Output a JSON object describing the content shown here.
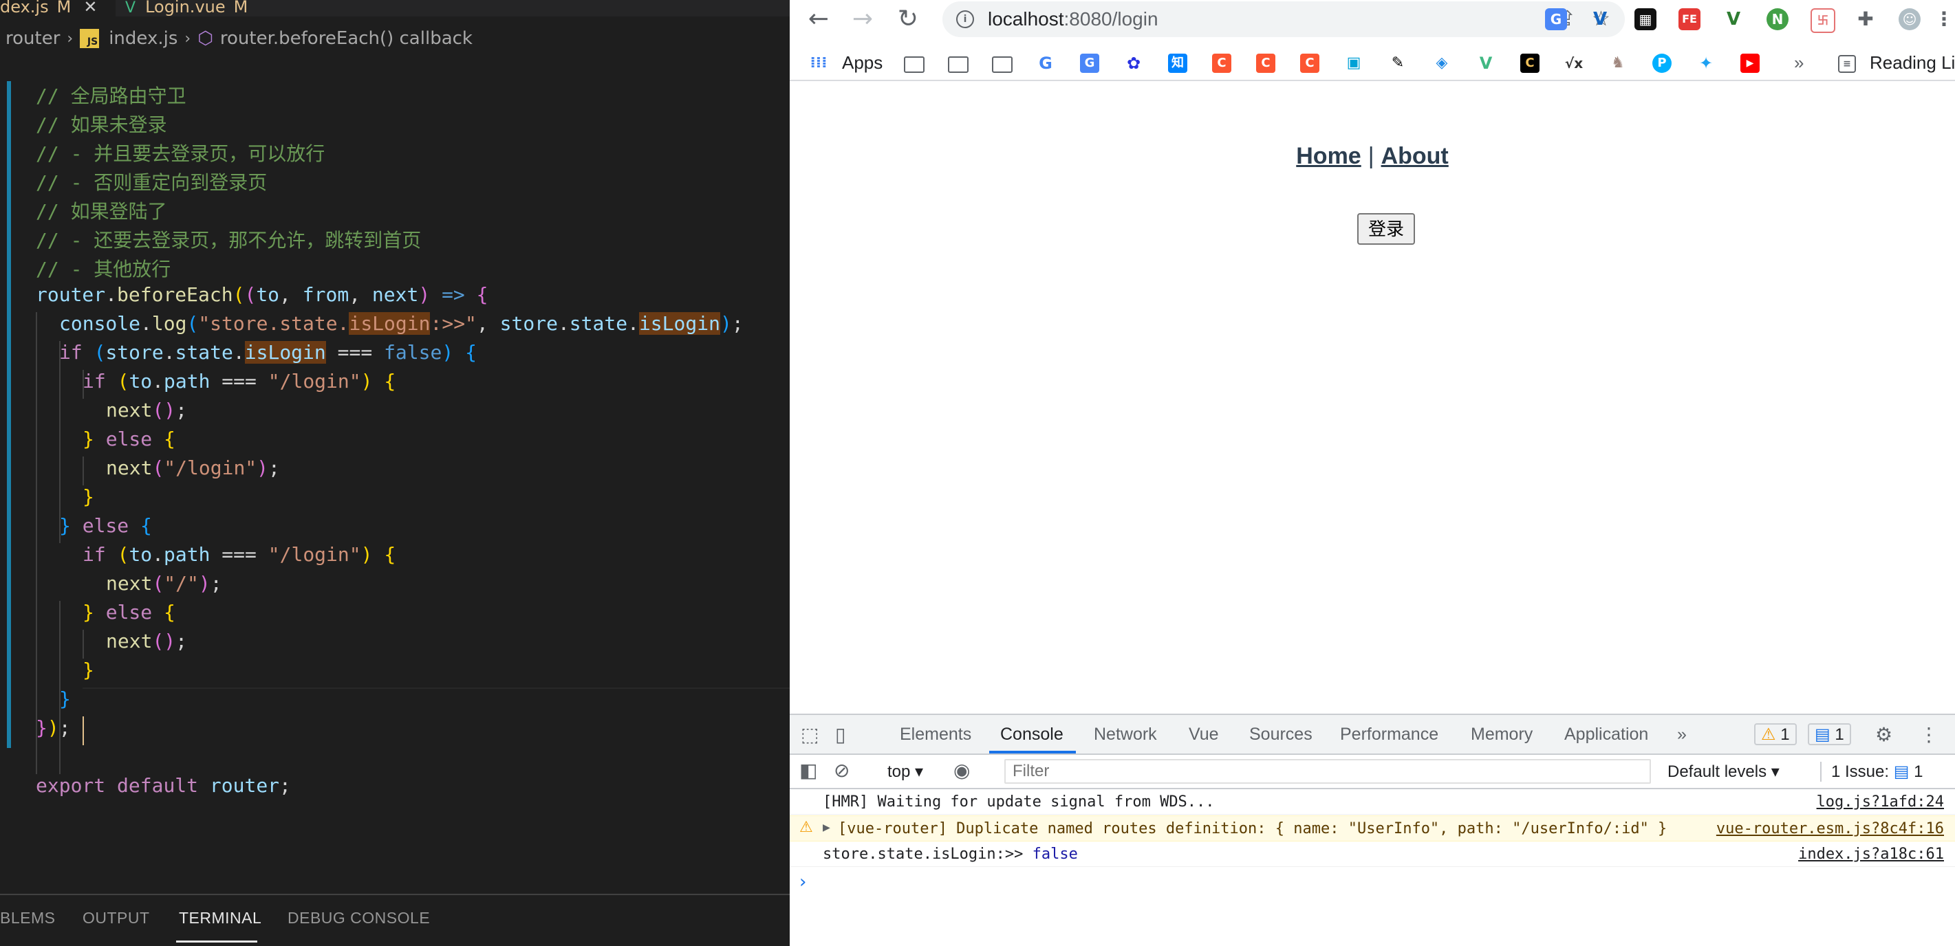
{
  "editor": {
    "tabs": [
      {
        "name": "dex.js",
        "modified": "M"
      },
      {
        "name": "Login.vue",
        "modified": "M"
      }
    ],
    "breadcrumb": [
      "router",
      "index.js",
      "router.beforeEach() callback"
    ],
    "panel_tabs": [
      "BLEMS",
      "OUTPUT",
      "TERMINAL",
      "DEBUG CONSOLE"
    ],
    "active_panel_tab": "TERMINAL",
    "code": {
      "l0": "// 全局路由守卫",
      "l1": "// 如果未登录",
      "l2": "// - 并且要去登录页，可以放行",
      "l3": "// - 否则重定向到登录页",
      "l4": "// 如果登陆了",
      "l5": "// - 还要去登录页，那不允许，跳转到首页",
      "l6": "// - 其他放行",
      "l18_str": "\"/login\"",
      "l21_str": "\"/\"",
      "log_str": "\"store.state.",
      "log_str_hl": "isLogin",
      "log_str_end": ":>>\"",
      "export": "export default router;"
    }
  },
  "browser": {
    "url_host": "localhost",
    "url_rest": ":8080/login",
    "bookmarks_apps": "Apps",
    "bookmarks_more": "»",
    "reading_list": "Reading List",
    "page_nav": {
      "home": "Home",
      "sep": "|",
      "about": "About"
    },
    "login_button": "登录",
    "devtools": {
      "tabs": [
        "Elements",
        "Console",
        "Network",
        "Vue",
        "Sources",
        "Performance",
        "Memory",
        "Application"
      ],
      "active_tab": "Console",
      "more": "»",
      "warn_count": "1",
      "msg_count": "1",
      "context": "top",
      "filter_placeholder": "Filter",
      "levels": "Default levels ▾",
      "issues_label": "1 Issue:",
      "issues_count": "1",
      "console_lines": [
        {
          "text": "[HMR] Waiting for update signal from WDS...",
          "source": "log.js?1afd:24"
        },
        {
          "text": "[vue-router] Duplicate named routes definition: { name: \"UserInfo\", path: \"/userInfo/:id\" }",
          "source": "vue-router.esm.js?8c4f:16"
        },
        {
          "text": "store.state.isLogin:>>",
          "value": "false",
          "source": "index.js?a18c:61"
        }
      ],
      "prompt": "›"
    }
  },
  "colors": {
    "editor_bg": "#1e1e1e",
    "comment": "#6a9955",
    "keyword": "#c586c0",
    "variable": "#9cdcfe",
    "string": "#ce9178",
    "devtools_accent": "#1a73e8"
  }
}
